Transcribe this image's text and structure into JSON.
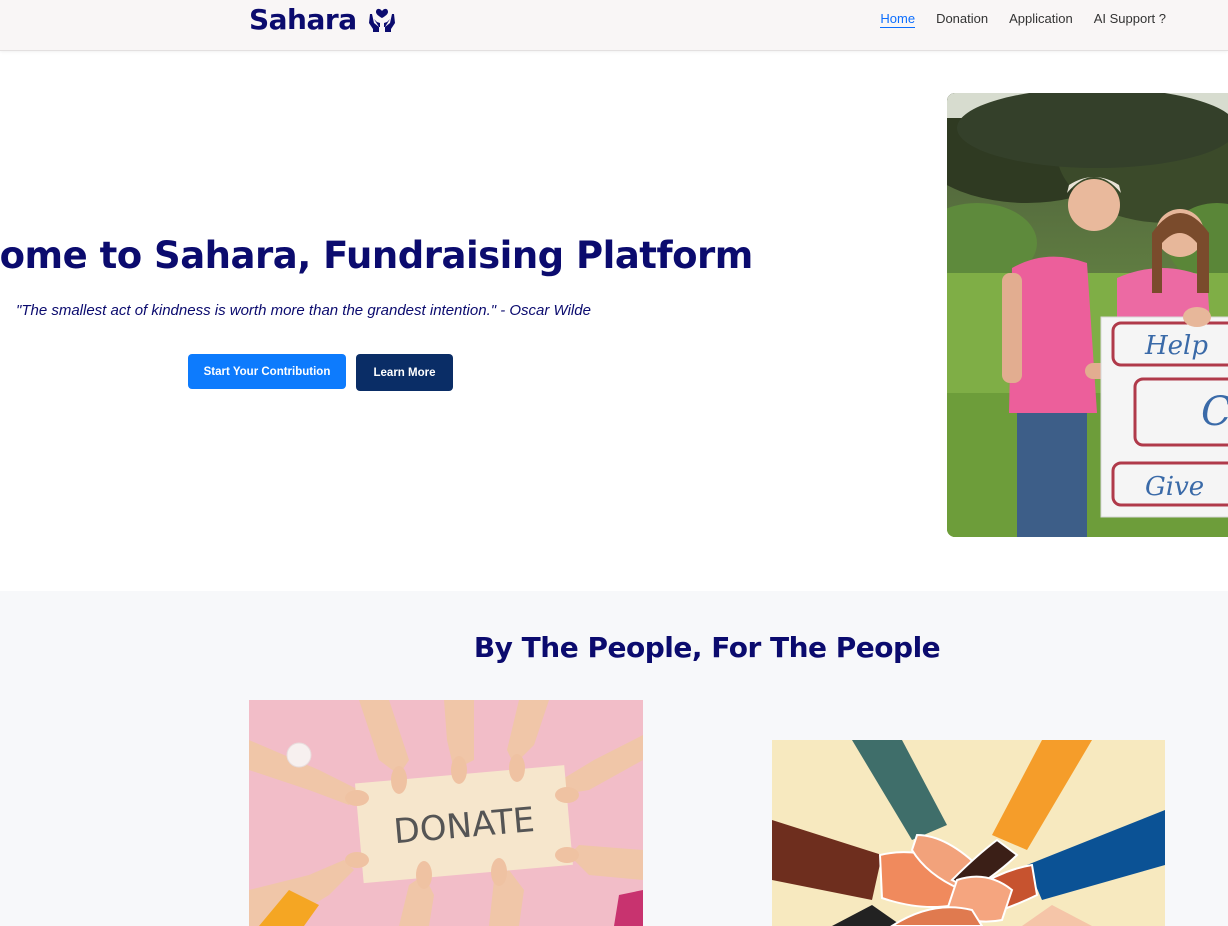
{
  "navbar": {
    "brand": "Sahara",
    "brand_icon": "hands-heart-icon",
    "links": [
      {
        "label": "Home",
        "active": true
      },
      {
        "label": "Donation",
        "active": false
      },
      {
        "label": "Application",
        "active": false
      },
      {
        "label": "AI Support ?",
        "active": false
      }
    ]
  },
  "hero": {
    "title": "lcome to Sahara, Fundraising Platform",
    "quote": "\"The smallest act of kindness is worth more than the grandest intention.\" - Oscar Wilde",
    "primary_button": "Start Your Contribution",
    "secondary_button": "Learn More",
    "photo_sign": {
      "top": "Help",
      "middle": "C",
      "bottom": "Give"
    }
  },
  "section2": {
    "title": "By The People, For The People",
    "donate_card": {
      "sign": "DONATE"
    }
  },
  "colors": {
    "navy": "#0b0b6e",
    "primary_blue": "#0d7bfd",
    "dark_button": "#0a2d66",
    "navbar_bg": "#f9f6f6",
    "section_bg": "#f7f8fa",
    "donate_bg": "#f2bdc8"
  }
}
